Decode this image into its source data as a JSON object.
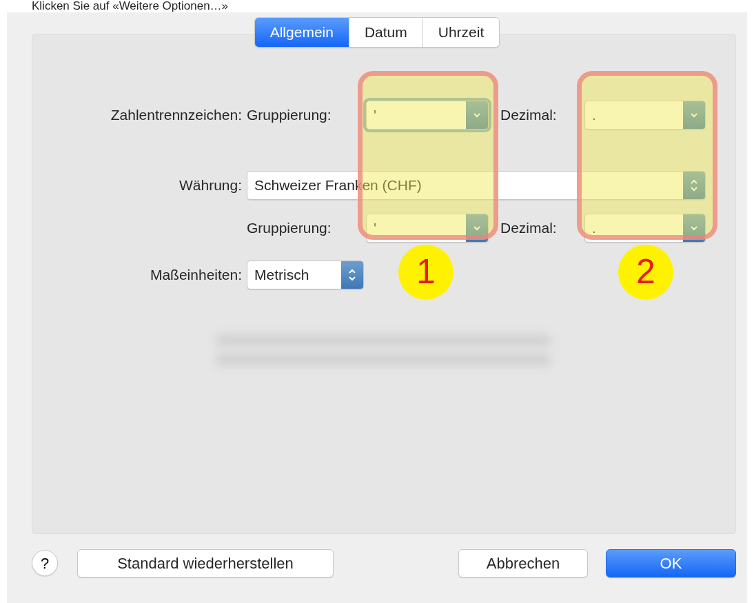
{
  "caption": "Klicken Sie auf «Weitere Optionen…»",
  "tabs": [
    {
      "label": "Allgemein",
      "selected": true
    },
    {
      "label": "Datum",
      "selected": false
    },
    {
      "label": "Uhrzeit",
      "selected": false
    }
  ],
  "form": [
    {
      "kind": "separators",
      "label": "Zahlentrennzeichen:",
      "grouping_label": "Gruppierung:",
      "grouping_value": "'",
      "grouping_focused": true,
      "decimal_label": "Dezimal:",
      "decimal_value": "."
    },
    {
      "kind": "wide-popup",
      "label": "Währung:",
      "value": "Schweizer Franken (CHF)"
    },
    {
      "kind": "separators",
      "grouping_label": "Gruppierung:",
      "grouping_value": "'",
      "grouping_focused": false,
      "decimal_label": "Dezimal:",
      "decimal_value": "."
    },
    {
      "kind": "short-popup",
      "label": "Maßeinheiten:",
      "value": "Metrisch"
    }
  ],
  "annotations": [
    {
      "label": "1"
    },
    {
      "label": "2"
    }
  ],
  "help_button": "?",
  "buttons": [
    {
      "label": "Standard wiederherstellen",
      "kind": "plain"
    },
    {
      "label": "Abbrechen",
      "kind": "plain"
    },
    {
      "label": "OK",
      "kind": "default"
    }
  ]
}
